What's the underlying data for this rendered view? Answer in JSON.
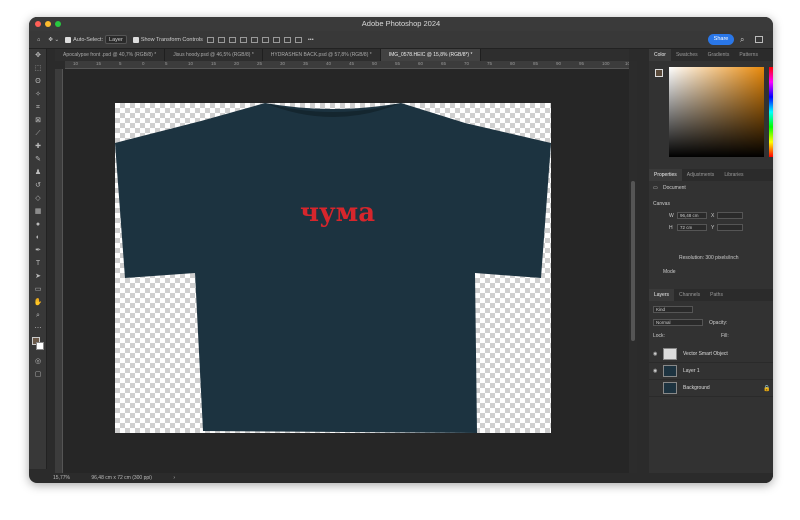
{
  "window": {
    "title": "Adobe Photoshop 2024"
  },
  "options_bar": {
    "auto_select_label": "Auto-Select:",
    "auto_select_value": "Layer",
    "transform_label": "Show Transform Controls",
    "more": "•••",
    "share_label": "Share"
  },
  "tabs": [
    {
      "label": "Apocalypse front .psd @ 40,7% (RGB/8) *"
    },
    {
      "label": "Jisus hoody.psd @ 46,5% (RGB/8) *"
    },
    {
      "label": "HYDRASHEN BACK.psd @ 57,8% (RGB/8) *"
    },
    {
      "label": "IMG_0578.HEIC @ 15,8% (RGB/8*) *"
    }
  ],
  "ruler_ticks": [
    "10",
    "15",
    "5",
    "0",
    "5",
    "10",
    "15",
    "20",
    "25",
    "30",
    "35",
    "40",
    "45",
    "50",
    "55",
    "60",
    "65",
    "70",
    "75",
    "80",
    "85",
    "90",
    "95",
    "100",
    "105"
  ],
  "canvas": {
    "shirt_text": "чума",
    "shirt_color": "#1c3340",
    "text_color": "#d6262c"
  },
  "status": {
    "zoom": "15,77%",
    "size": "96,48 cm x 72 cm (300 ppi)",
    "arrow": "›"
  },
  "color_panel": {
    "tabs": [
      "Color",
      "Swatches",
      "Gradients",
      "Patterns"
    ]
  },
  "properties_panel": {
    "tabs": [
      "Properties",
      "Adjustments",
      "Libraries"
    ],
    "doc_label": "Document",
    "canvas_label": "Canvas",
    "w_label": "W",
    "w_value": "96,48 cm",
    "x_label": "X",
    "h_label": "H",
    "h_value": "72 cm",
    "y_label": "Y",
    "resolution": "Resolution: 300 pixels/inch",
    "mode_label": "Mode"
  },
  "layers_panel": {
    "tabs": [
      "Layers",
      "Channels",
      "Paths"
    ],
    "kind_label": "Kind",
    "blend": "Normal",
    "opacity": "Opacity:",
    "lock": "Lock:",
    "fill": "Fill:",
    "layers": [
      {
        "name": "Vector Smart Object"
      },
      {
        "name": "Layer 1"
      },
      {
        "name": "Background"
      }
    ]
  }
}
